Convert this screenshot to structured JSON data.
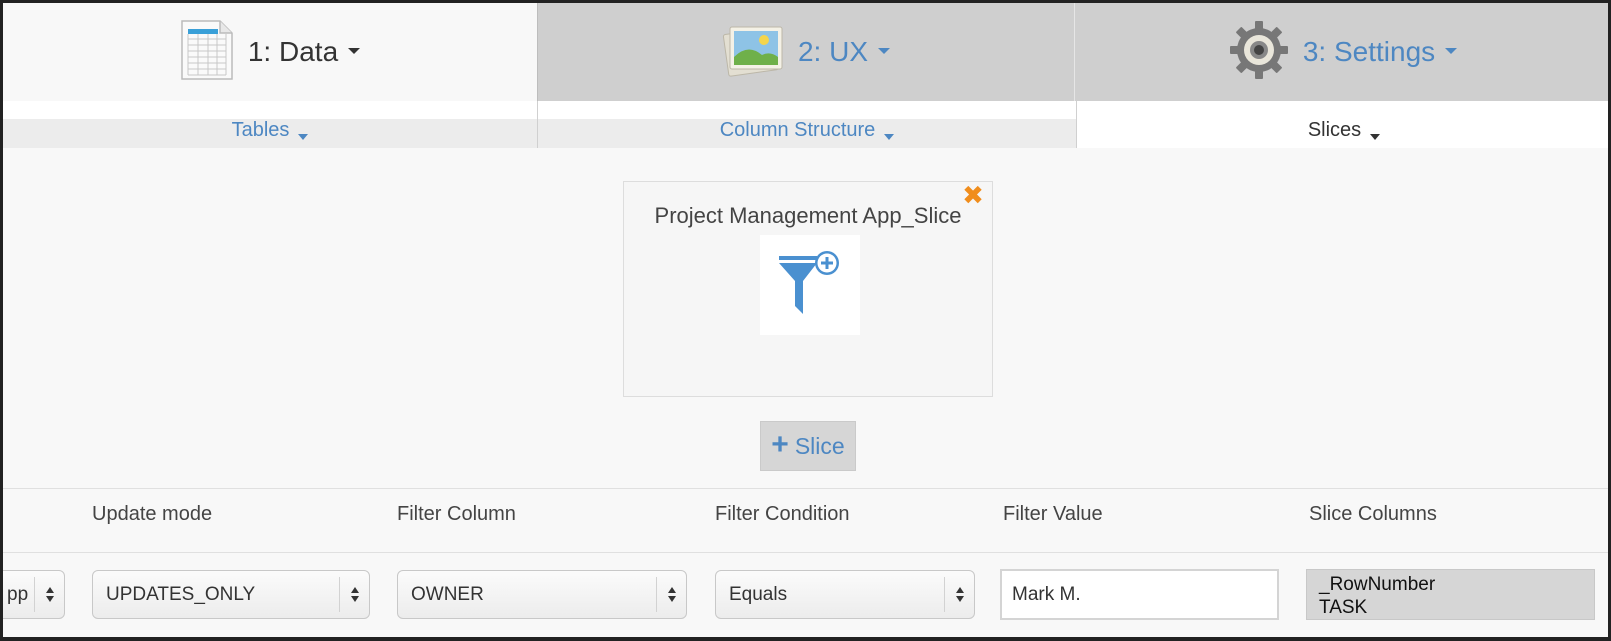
{
  "top_tabs": [
    {
      "label": "1: Data",
      "icon": "spreadsheet-icon",
      "active": true
    },
    {
      "label": "2: UX",
      "icon": "image-icon",
      "active": false
    },
    {
      "label": "3: Settings",
      "icon": "gear-icon",
      "active": false
    }
  ],
  "sub_tabs": [
    {
      "label": "Tables",
      "active": false
    },
    {
      "label": "Column Structure",
      "active": false
    },
    {
      "label": "Slices",
      "active": true
    }
  ],
  "slice_card": {
    "title": "Project Management App_Slice",
    "close_glyph": "✖",
    "icon": "filter-add-icon"
  },
  "add_slice": {
    "plus": "+",
    "label": "Slice"
  },
  "columns": {
    "update_mode": "Update mode",
    "filter_column": "Filter Column",
    "filter_condition": "Filter Condition",
    "filter_value": "Filter Value",
    "slice_columns": "Slice Columns"
  },
  "row": {
    "first_select_value": "pp",
    "update_mode": "UPDATES_ONLY",
    "filter_column": "OWNER",
    "filter_condition": "Equals",
    "filter_value": "Mark M.",
    "slice_columns": [
      "_RowNumber",
      "TASK"
    ]
  },
  "colors": {
    "accent": "#4d87c2",
    "close": "#f08d1c",
    "inactive_tab": "#cfcfcf"
  }
}
